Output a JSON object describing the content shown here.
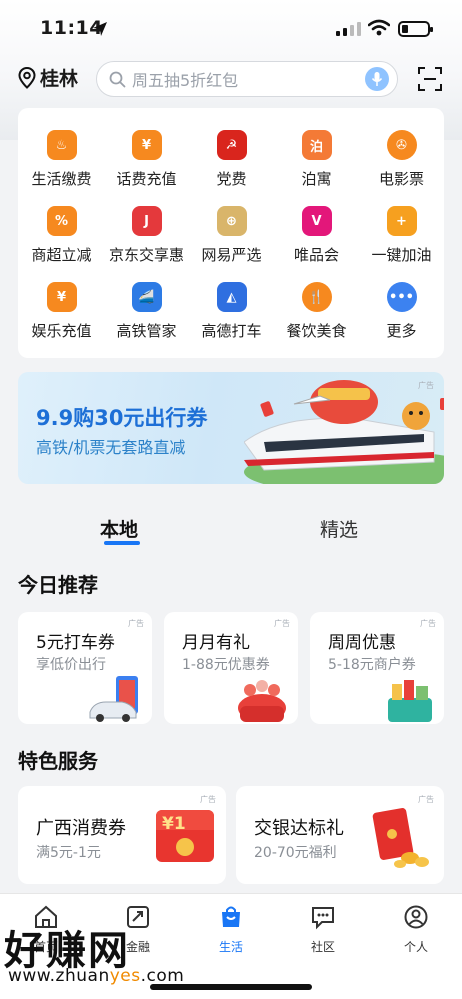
{
  "status_bar": {
    "time": "11:14"
  },
  "header": {
    "city": "桂林",
    "search_placeholder": "周五抽5折红包"
  },
  "services": [
    {
      "label": "生活缴费",
      "icon": "flame-icon",
      "color": "#f6891f",
      "glyph": "♨"
    },
    {
      "label": "话费充值",
      "icon": "yen-phone-icon",
      "color": "#f6891f",
      "glyph": "¥"
    },
    {
      "label": "党费",
      "icon": "party-emblem-icon",
      "color": "#d9251d",
      "glyph": "☭"
    },
    {
      "label": "泊寓",
      "icon": "boyu-icon",
      "color": "#f47a36",
      "glyph": "泊"
    },
    {
      "label": "电影票",
      "icon": "film-reel-icon",
      "color": "#f6891f",
      "glyph": "✇"
    },
    {
      "label": "商超立减",
      "icon": "percent-tag-icon",
      "color": "#f6891f",
      "glyph": "%"
    },
    {
      "label": "京东交享惠",
      "icon": "jd-dog-icon",
      "color": "#e4393c",
      "glyph": "J"
    },
    {
      "label": "网易严选",
      "icon": "yanxuan-icon",
      "color": "#d9b56a",
      "glyph": "⊕"
    },
    {
      "label": "唯品会",
      "icon": "vip-icon",
      "color": "#e3177a",
      "glyph": "V"
    },
    {
      "label": "一键加油",
      "icon": "fuel-icon",
      "color": "#f6a01f",
      "glyph": "+"
    },
    {
      "label": "娱乐充值",
      "icon": "yen-card-icon",
      "color": "#f6891f",
      "glyph": "¥"
    },
    {
      "label": "高铁管家",
      "icon": "train-icon",
      "color": "#2d7be5",
      "glyph": "🚄"
    },
    {
      "label": "高德打车",
      "icon": "amap-icon",
      "color": "#2f6fe0",
      "glyph": "◭"
    },
    {
      "label": "餐饮美食",
      "icon": "fork-knife-icon",
      "color": "#f6891f",
      "glyph": "🍴"
    },
    {
      "label": "更多",
      "icon": "more-dots-icon",
      "color": "#3c82f0",
      "glyph": "•••"
    }
  ],
  "banner": {
    "title": "9.9购30元出行券",
    "subtitle": "高铁/机票无套路直减",
    "ad": "广告"
  },
  "tabs": [
    {
      "label": "本地",
      "active": true
    },
    {
      "label": "精选",
      "active": false
    }
  ],
  "today": {
    "title": "今日推荐",
    "cards": [
      {
        "title": "5元打车券",
        "subtitle": "享低价出行",
        "ad": "广告"
      },
      {
        "title": "月月有礼",
        "subtitle": "1-88元优惠券",
        "ad": "广告"
      },
      {
        "title": "周周优惠",
        "subtitle": "5-18元商户券",
        "ad": "广告"
      }
    ]
  },
  "featured": {
    "title": "特色服务",
    "cards": [
      {
        "title": "广西消费券",
        "subtitle": "满5元-1元",
        "ad": "广告",
        "coupon": "¥1"
      },
      {
        "title": "交银达标礼",
        "subtitle": "20-70元福利",
        "ad": "广告"
      }
    ]
  },
  "bottom_nav": [
    {
      "label": "首页",
      "icon": "home-icon",
      "active": false
    },
    {
      "label": "金融",
      "icon": "finance-icon",
      "active": false
    },
    {
      "label": "生活",
      "icon": "life-bag-icon",
      "active": true
    },
    {
      "label": "社区",
      "icon": "community-chat-icon",
      "active": false
    },
    {
      "label": "个人",
      "icon": "person-icon",
      "active": false
    }
  ],
  "watermark": {
    "text": "好赚网",
    "url_prefix": "www.zhuan",
    "url_highlight": "yes",
    "url_suffix": ".com"
  }
}
